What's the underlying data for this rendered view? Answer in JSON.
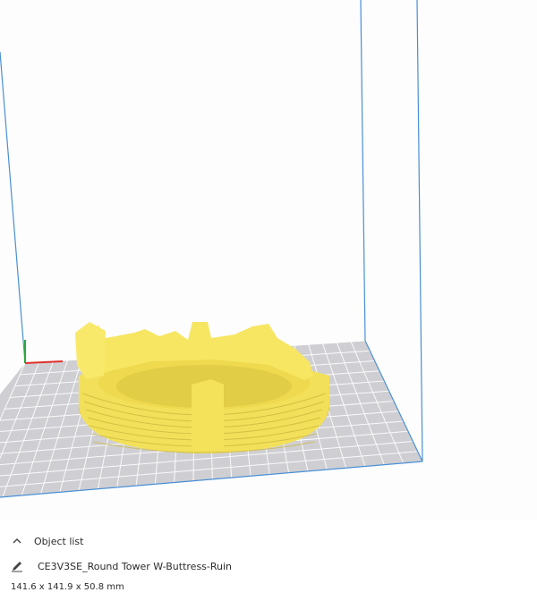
{
  "object_list": {
    "header_label": "Object list",
    "toggle_icon": "chevron-up-icon",
    "items": [
      {
        "name": "CE3V3SE_Round Tower W-Buttress-Ruin",
        "edit_icon": "pencil-icon"
      }
    ],
    "dimensions": "141.6 x 141.9 x 50.8 mm"
  },
  "colors": {
    "model": "#f5e65a",
    "build_plate": "#c8c8cc",
    "grid_lines": "#ffffff",
    "volume_edges": "#4a8fd6",
    "axis_x": "#e0302a",
    "axis_y": "#2aa83a"
  }
}
